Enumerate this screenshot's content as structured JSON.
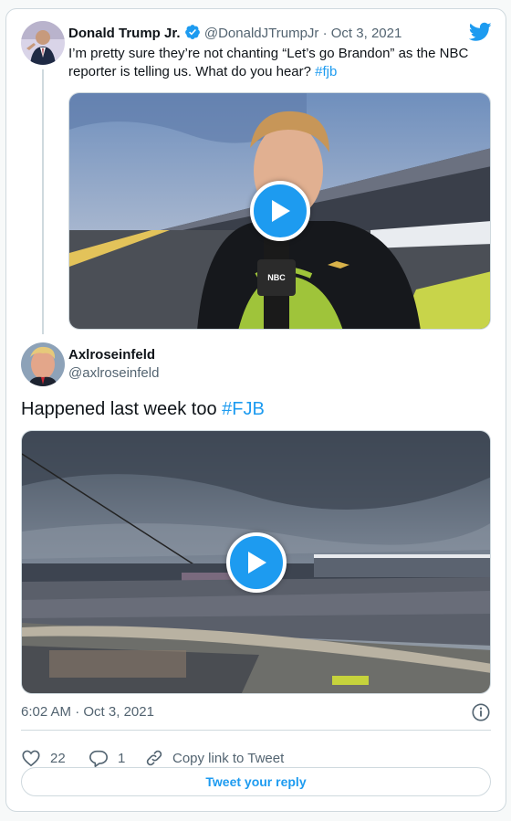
{
  "quoted": {
    "author_name": "Donald Trump Jr.",
    "handle": "@DonaldJTrumpJr",
    "separator": "·",
    "date": "Oct 3, 2021",
    "text": "I’m pretty sure they’re not chanting “Let’s go Brandon” as the NBC reporter is telling us. What do you hear?",
    "hashtag": "#fjb"
  },
  "reply": {
    "author_name": "Axlroseinfeld",
    "handle": "@axlroseinfeld",
    "text": "Happened last week too",
    "hashtag": "#FJB"
  },
  "meta": {
    "time": "6:02 AM",
    "separator": "·",
    "date": "Oct 3, 2021"
  },
  "actions": {
    "like_count": "22",
    "reply_count": "1",
    "copy_link_label": "Copy link to Tweet",
    "reply_button_label": "Tweet your reply"
  },
  "icons": {
    "brand": "twitter-bird-icon",
    "verified": "verified-badge-icon",
    "info": "info-icon",
    "like": "heart-icon",
    "reply": "reply-bubble-icon",
    "copy": "link-icon",
    "play": "play-icon"
  },
  "colors": {
    "accent": "#1d9bf0",
    "text": "#0f1419",
    "secondary": "#536471",
    "border": "#cfd9de"
  }
}
